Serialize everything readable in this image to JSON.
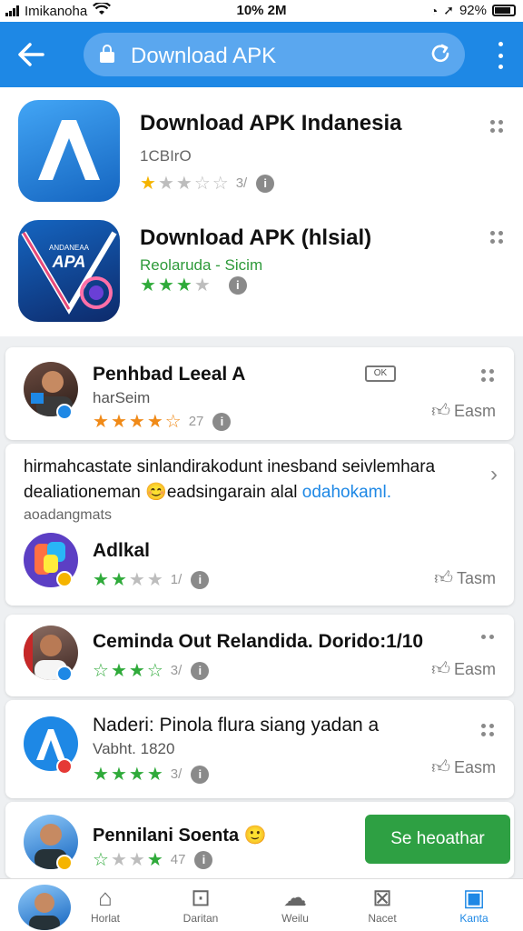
{
  "status_bar": {
    "carrier": "Imikanoha",
    "center": "10% 2M",
    "battery": "92%"
  },
  "browser": {
    "back_icon": "back-arrow-icon",
    "url_text": "Download APK"
  },
  "apps": [
    {
      "title": "Download APK Indanesia",
      "subtitle": "1CBIrO",
      "rating_count": "3/",
      "icon_text": ""
    },
    {
      "title": "Download APK (hlsial)",
      "subtitle": "Reolaruda - Sicim",
      "icon_text": "APA",
      "icon_subtext": "ANDANEAA"
    }
  ],
  "reviews": [
    {
      "name": "Penhbad Leeal A",
      "sub": "harSeim",
      "count": "27",
      "badge": "OK",
      "like": "Easm"
    },
    {
      "description_line1": "hirmahcastate sinlandirakodunt inesband seivlemhara",
      "description_line2a": "dealiationeman",
      "description_line2b": "eadsingarain alal",
      "description_link": "odahokaml.",
      "small_meta": "aoadangmats",
      "name": "Adlkal",
      "count": "1/",
      "like": "Tasm"
    },
    {
      "name": "Ceminda Out Relandida. Dorido:1/10",
      "count": "3/",
      "like": "Easm"
    },
    {
      "name": "Naderi: Pinola flura siang yadan a",
      "sub": "Vabht. 1820",
      "count": "3/",
      "like": "Easm"
    },
    {
      "name": "Pennilani Soenta",
      "count": "47",
      "button": "Se heoathar"
    }
  ],
  "nav": {
    "items": [
      {
        "label": "Horlat",
        "icon": "home-icon"
      },
      {
        "label": "Daritan",
        "icon": "download-box-icon"
      },
      {
        "label": "Weilu",
        "icon": "chat-cloud-icon"
      },
      {
        "label": "Nacet",
        "icon": "x-box-icon"
      },
      {
        "label": "Kanta",
        "icon": "profile-card-icon"
      }
    ]
  },
  "colors": {
    "primary": "#1e88e5",
    "star_gold": "#f5b400",
    "star_orange": "#f08a18",
    "star_green": "#2faa3a",
    "button_green": "#2ea043"
  }
}
